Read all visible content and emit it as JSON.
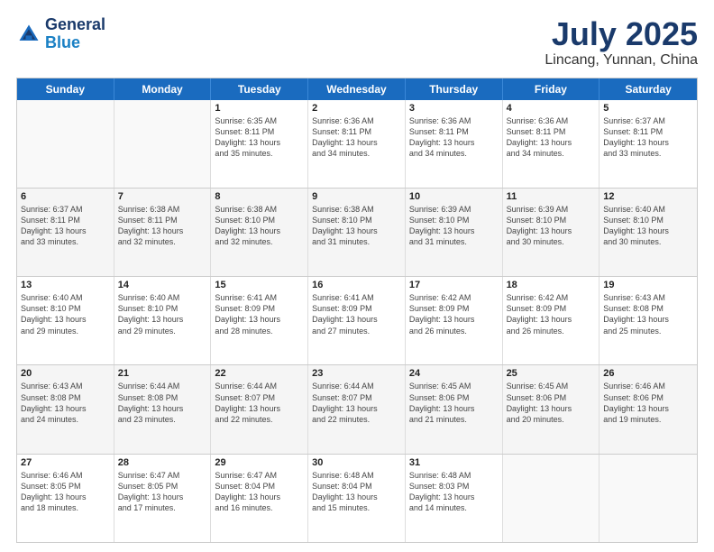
{
  "logo": {
    "line1": "General",
    "line2": "Blue"
  },
  "title": "July 2025",
  "subtitle": "Lincang, Yunnan, China",
  "weekdays": [
    "Sunday",
    "Monday",
    "Tuesday",
    "Wednesday",
    "Thursday",
    "Friday",
    "Saturday"
  ],
  "weeks": [
    [
      {
        "day": "",
        "info": "",
        "empty": true
      },
      {
        "day": "",
        "info": "",
        "empty": true
      },
      {
        "day": "1",
        "info": "Sunrise: 6:35 AM\nSunset: 8:11 PM\nDaylight: 13 hours\nand 35 minutes."
      },
      {
        "day": "2",
        "info": "Sunrise: 6:36 AM\nSunset: 8:11 PM\nDaylight: 13 hours\nand 34 minutes."
      },
      {
        "day": "3",
        "info": "Sunrise: 6:36 AM\nSunset: 8:11 PM\nDaylight: 13 hours\nand 34 minutes."
      },
      {
        "day": "4",
        "info": "Sunrise: 6:36 AM\nSunset: 8:11 PM\nDaylight: 13 hours\nand 34 minutes."
      },
      {
        "day": "5",
        "info": "Sunrise: 6:37 AM\nSunset: 8:11 PM\nDaylight: 13 hours\nand 33 minutes."
      }
    ],
    [
      {
        "day": "6",
        "info": "Sunrise: 6:37 AM\nSunset: 8:11 PM\nDaylight: 13 hours\nand 33 minutes."
      },
      {
        "day": "7",
        "info": "Sunrise: 6:38 AM\nSunset: 8:11 PM\nDaylight: 13 hours\nand 32 minutes."
      },
      {
        "day": "8",
        "info": "Sunrise: 6:38 AM\nSunset: 8:10 PM\nDaylight: 13 hours\nand 32 minutes."
      },
      {
        "day": "9",
        "info": "Sunrise: 6:38 AM\nSunset: 8:10 PM\nDaylight: 13 hours\nand 31 minutes."
      },
      {
        "day": "10",
        "info": "Sunrise: 6:39 AM\nSunset: 8:10 PM\nDaylight: 13 hours\nand 31 minutes."
      },
      {
        "day": "11",
        "info": "Sunrise: 6:39 AM\nSunset: 8:10 PM\nDaylight: 13 hours\nand 30 minutes."
      },
      {
        "day": "12",
        "info": "Sunrise: 6:40 AM\nSunset: 8:10 PM\nDaylight: 13 hours\nand 30 minutes."
      }
    ],
    [
      {
        "day": "13",
        "info": "Sunrise: 6:40 AM\nSunset: 8:10 PM\nDaylight: 13 hours\nand 29 minutes."
      },
      {
        "day": "14",
        "info": "Sunrise: 6:40 AM\nSunset: 8:10 PM\nDaylight: 13 hours\nand 29 minutes."
      },
      {
        "day": "15",
        "info": "Sunrise: 6:41 AM\nSunset: 8:09 PM\nDaylight: 13 hours\nand 28 minutes."
      },
      {
        "day": "16",
        "info": "Sunrise: 6:41 AM\nSunset: 8:09 PM\nDaylight: 13 hours\nand 27 minutes."
      },
      {
        "day": "17",
        "info": "Sunrise: 6:42 AM\nSunset: 8:09 PM\nDaylight: 13 hours\nand 26 minutes."
      },
      {
        "day": "18",
        "info": "Sunrise: 6:42 AM\nSunset: 8:09 PM\nDaylight: 13 hours\nand 26 minutes."
      },
      {
        "day": "19",
        "info": "Sunrise: 6:43 AM\nSunset: 8:08 PM\nDaylight: 13 hours\nand 25 minutes."
      }
    ],
    [
      {
        "day": "20",
        "info": "Sunrise: 6:43 AM\nSunset: 8:08 PM\nDaylight: 13 hours\nand 24 minutes."
      },
      {
        "day": "21",
        "info": "Sunrise: 6:44 AM\nSunset: 8:08 PM\nDaylight: 13 hours\nand 23 minutes."
      },
      {
        "day": "22",
        "info": "Sunrise: 6:44 AM\nSunset: 8:07 PM\nDaylight: 13 hours\nand 22 minutes."
      },
      {
        "day": "23",
        "info": "Sunrise: 6:44 AM\nSunset: 8:07 PM\nDaylight: 13 hours\nand 22 minutes."
      },
      {
        "day": "24",
        "info": "Sunrise: 6:45 AM\nSunset: 8:06 PM\nDaylight: 13 hours\nand 21 minutes."
      },
      {
        "day": "25",
        "info": "Sunrise: 6:45 AM\nSunset: 8:06 PM\nDaylight: 13 hours\nand 20 minutes."
      },
      {
        "day": "26",
        "info": "Sunrise: 6:46 AM\nSunset: 8:06 PM\nDaylight: 13 hours\nand 19 minutes."
      }
    ],
    [
      {
        "day": "27",
        "info": "Sunrise: 6:46 AM\nSunset: 8:05 PM\nDaylight: 13 hours\nand 18 minutes."
      },
      {
        "day": "28",
        "info": "Sunrise: 6:47 AM\nSunset: 8:05 PM\nDaylight: 13 hours\nand 17 minutes."
      },
      {
        "day": "29",
        "info": "Sunrise: 6:47 AM\nSunset: 8:04 PM\nDaylight: 13 hours\nand 16 minutes."
      },
      {
        "day": "30",
        "info": "Sunrise: 6:48 AM\nSunset: 8:04 PM\nDaylight: 13 hours\nand 15 minutes."
      },
      {
        "day": "31",
        "info": "Sunrise: 6:48 AM\nSunset: 8:03 PM\nDaylight: 13 hours\nand 14 minutes."
      },
      {
        "day": "",
        "info": "",
        "empty": true
      },
      {
        "day": "",
        "info": "",
        "empty": true
      }
    ]
  ]
}
